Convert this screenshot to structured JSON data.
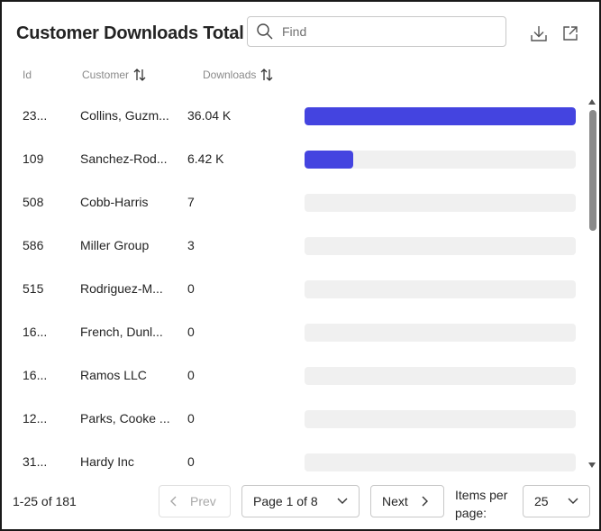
{
  "header": {
    "title": "Customer Downloads Total",
    "search_placeholder": "Find",
    "icons": {
      "search": "search-icon",
      "download": "download-icon",
      "open": "open-external-icon"
    }
  },
  "columns": {
    "id": "Id",
    "customer": "Customer",
    "downloads": "Downloads"
  },
  "rows": [
    {
      "id": "23...",
      "customer": "Collins, Guzm...",
      "downloads": "36.04 K",
      "fraction": 1.0
    },
    {
      "id": "109",
      "customer": "Sanchez-Rod...",
      "downloads": "6.42 K",
      "fraction": 0.178
    },
    {
      "id": "508",
      "customer": "Cobb-Harris",
      "downloads": "7",
      "fraction": 0
    },
    {
      "id": "586",
      "customer": "Miller Group",
      "downloads": "3",
      "fraction": 0
    },
    {
      "id": "515",
      "customer": "Rodriguez-M...",
      "downloads": "0",
      "fraction": 0
    },
    {
      "id": "16...",
      "customer": "French, Dunl...",
      "downloads": "0",
      "fraction": 0
    },
    {
      "id": "16...",
      "customer": "Ramos LLC",
      "downloads": "0",
      "fraction": 0
    },
    {
      "id": "12...",
      "customer": "Parks, Cooke ...",
      "downloads": "0",
      "fraction": 0
    },
    {
      "id": "31...",
      "customer": "Hardy Inc",
      "downloads": "0",
      "fraction": 0
    }
  ],
  "colors": {
    "bar": "#4444e0",
    "track": "#f0f0f0"
  },
  "footer": {
    "count": "1-25 of 181",
    "prev": "Prev",
    "page": "Page 1 of 8",
    "next": "Next",
    "items_per_page_label": "Items per page:",
    "items_per_page": "25"
  }
}
